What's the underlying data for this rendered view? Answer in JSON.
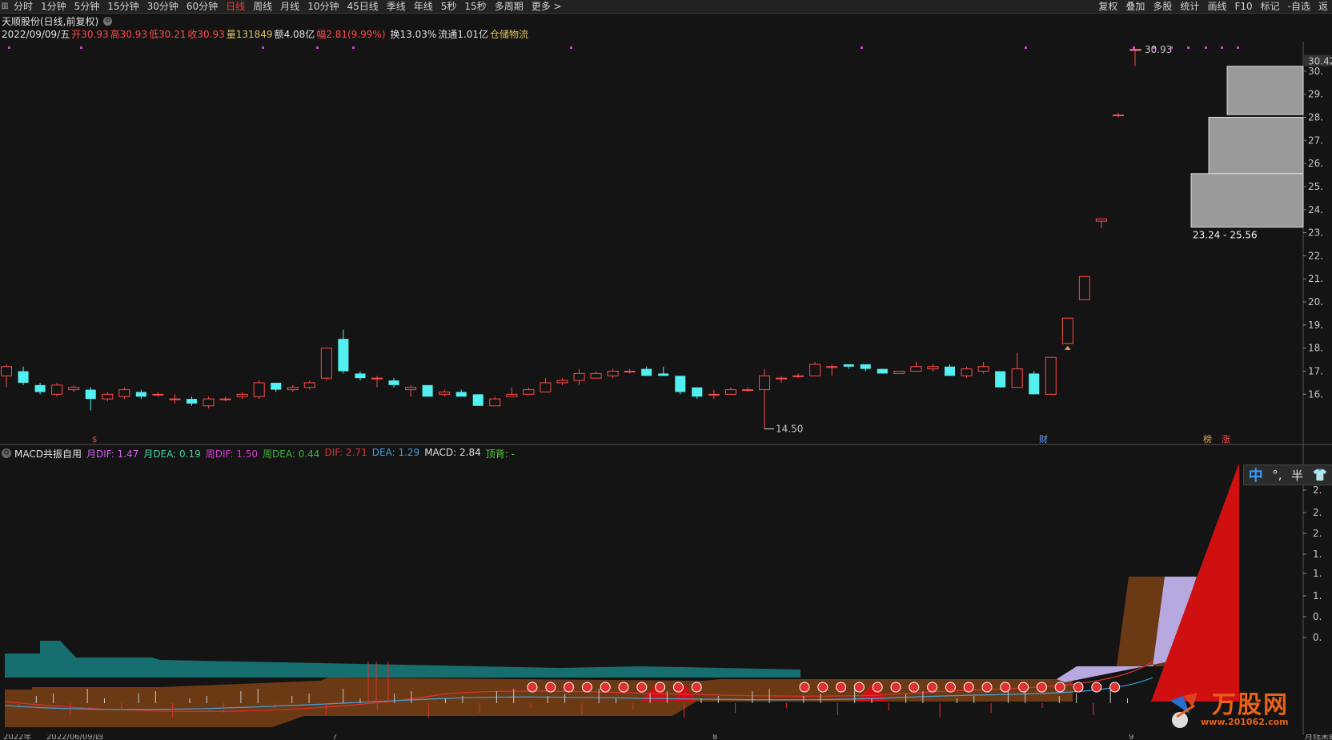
{
  "toolbar": {
    "left_items": [
      "分时",
      "1分钟",
      "5分钟",
      "15分钟",
      "30分钟",
      "60分钟",
      "日线",
      "周线",
      "月线",
      "10分钟",
      "45日线",
      "季线",
      "年线",
      "5秒",
      "15秒",
      "多周期",
      "更多 >"
    ],
    "active_index": 6,
    "right_items": [
      "复权",
      "叠加",
      "多股",
      "统计",
      "画线",
      "F10",
      "标记",
      "-自选",
      "返"
    ]
  },
  "stock": {
    "title": "天顺股份(日线,前复权)",
    "date": "2022/09/09/五",
    "open_label": "开",
    "open": "30.93",
    "high_label": "高",
    "high": "30.93",
    "low_label": "低",
    "low": "30.21",
    "close_label": "收",
    "close": "30.93",
    "volume_label": "量",
    "volume": "131849",
    "amount_label": "额",
    "amount": "4.08亿",
    "change_label": "幅",
    "change": "2.81(9.99%)",
    "turnover_label": "换",
    "turnover": "13.03%",
    "float_label": "流通",
    "float": "1.01亿",
    "sector": "仓储物流"
  },
  "price_axis": [
    "30.42",
    "30.",
    "29.",
    "28.",
    "27.",
    "26.",
    "25.",
    "24.",
    "23.",
    "22.",
    "21.",
    "20.",
    "19.",
    "18.",
    "17.",
    "16."
  ],
  "annotations": {
    "high_marker": "30.93",
    "low_marker": "14.50",
    "zones": [
      "28.12 - 30.21",
      "25.56 - 28.00",
      "23.24 - 25.56"
    ],
    "events": [
      "财",
      "榜",
      "涨"
    ],
    "early_marker": "$"
  },
  "indicator": {
    "name": "MACD共振自用",
    "items": [
      {
        "label": "月DIF:",
        "value": "1.47",
        "color": "#d060f0"
      },
      {
        "label": "月DEA:",
        "value": "0.19",
        "color": "#40d0a0"
      },
      {
        "label": "周DIF:",
        "value": "1.50",
        "color": "#d040d0"
      },
      {
        "label": "周DEA:",
        "value": "0.44",
        "color": "#40b040"
      },
      {
        "label": "DIF:",
        "value": "2.71",
        "color": "#e03030"
      },
      {
        "label": "DEA:",
        "value": "1.29",
        "color": "#40a0e0"
      },
      {
        "label": "MACD:",
        "value": "2.84",
        "color": "#e0e0e0"
      },
      {
        "label": "顶背:",
        "value": "-",
        "color": "#60d040"
      }
    ],
    "axis": [
      "2.",
      "2.",
      "2.",
      "1.",
      "1.",
      "1.",
      "0.",
      "0."
    ]
  },
  "ime": {
    "mode": "中",
    "punct": "°,",
    "width": "半"
  },
  "watermark": {
    "text": "万股网",
    "url": "www.201062.com"
  },
  "bottom_axis": [
    "2022年",
    "2022/06/09/四",
    "7",
    "8",
    "9"
  ],
  "bottom_left_label": "月线未数据",
  "colors": {
    "up": "#ff4a4a",
    "down": "#52f0f0",
    "bg": "#141414",
    "teal": "#176e6e",
    "brown": "#6b3a14",
    "lavender": "#b8a8e0",
    "red_fill": "#d01010"
  },
  "chart_data": {
    "type": "candlestick",
    "ylim": [
      14.0,
      31.0
    ],
    "candles": [
      {
        "o": 16.8,
        "c": 17.2,
        "h": 17.3,
        "l": 16.3
      },
      {
        "o": 17.0,
        "c": 16.5,
        "h": 17.2,
        "l": 16.4
      },
      {
        "o": 16.4,
        "c": 16.1,
        "h": 16.5,
        "l": 16.0
      },
      {
        "o": 16.0,
        "c": 16.4,
        "h": 16.5,
        "l": 15.9
      },
      {
        "o": 16.2,
        "c": 16.3,
        "h": 16.4,
        "l": 16.1
      },
      {
        "o": 16.2,
        "c": 15.8,
        "h": 16.3,
        "l": 15.3
      },
      {
        "o": 15.8,
        "c": 16.0,
        "h": 16.1,
        "l": 15.7
      },
      {
        "o": 15.9,
        "c": 16.2,
        "h": 16.3,
        "l": 15.8
      },
      {
        "o": 16.1,
        "c": 15.9,
        "h": 16.2,
        "l": 15.8
      },
      {
        "o": 16.0,
        "c": 16.0,
        "h": 16.1,
        "l": 15.9
      },
      {
        "o": 15.8,
        "c": 15.8,
        "h": 16.0,
        "l": 15.6
      },
      {
        "o": 15.8,
        "c": 15.6,
        "h": 15.9,
        "l": 15.5
      },
      {
        "o": 15.5,
        "c": 15.8,
        "h": 15.9,
        "l": 15.4
      },
      {
        "o": 15.8,
        "c": 15.8,
        "h": 15.9,
        "l": 15.7
      },
      {
        "o": 15.9,
        "c": 16.0,
        "h": 16.1,
        "l": 15.8
      },
      {
        "o": 15.9,
        "c": 16.5,
        "h": 16.6,
        "l": 15.8
      },
      {
        "o": 16.5,
        "c": 16.2,
        "h": 16.5,
        "l": 16.1
      },
      {
        "o": 16.2,
        "c": 16.3,
        "h": 16.4,
        "l": 16.1
      },
      {
        "o": 16.3,
        "c": 16.5,
        "h": 16.6,
        "l": 16.2
      },
      {
        "o": 16.7,
        "c": 18.0,
        "h": 18.0,
        "l": 16.6
      },
      {
        "o": 18.4,
        "c": 17.0,
        "h": 18.8,
        "l": 16.9
      },
      {
        "o": 16.9,
        "c": 16.7,
        "h": 17.0,
        "l": 16.6
      },
      {
        "o": 16.7,
        "c": 16.7,
        "h": 16.8,
        "l": 16.3
      },
      {
        "o": 16.6,
        "c": 16.4,
        "h": 16.7,
        "l": 16.3
      },
      {
        "o": 16.2,
        "c": 16.3,
        "h": 16.4,
        "l": 15.9
      },
      {
        "o": 16.4,
        "c": 15.9,
        "h": 16.4,
        "l": 15.9
      },
      {
        "o": 16.0,
        "c": 16.1,
        "h": 16.2,
        "l": 15.9
      },
      {
        "o": 16.1,
        "c": 15.9,
        "h": 16.2,
        "l": 15.9
      },
      {
        "o": 16.0,
        "c": 15.5,
        "h": 16.0,
        "l": 15.5
      },
      {
        "o": 15.5,
        "c": 15.8,
        "h": 15.9,
        "l": 15.5
      },
      {
        "o": 15.9,
        "c": 16.0,
        "h": 16.3,
        "l": 15.9
      },
      {
        "o": 16.0,
        "c": 16.2,
        "h": 16.3,
        "l": 16.0
      },
      {
        "o": 16.1,
        "c": 16.5,
        "h": 16.7,
        "l": 16.1
      },
      {
        "o": 16.5,
        "c": 16.6,
        "h": 16.7,
        "l": 16.4
      },
      {
        "o": 16.6,
        "c": 16.9,
        "h": 17.1,
        "l": 16.4
      },
      {
        "o": 16.7,
        "c": 16.9,
        "h": 17.0,
        "l": 16.7
      },
      {
        "o": 16.8,
        "c": 17.0,
        "h": 17.1,
        "l": 16.7
      },
      {
        "o": 17.0,
        "c": 17.0,
        "h": 17.1,
        "l": 16.9
      },
      {
        "o": 17.1,
        "c": 16.8,
        "h": 17.2,
        "l": 16.8
      },
      {
        "o": 16.9,
        "c": 16.8,
        "h": 17.2,
        "l": 16.8
      },
      {
        "o": 16.8,
        "c": 16.1,
        "h": 16.8,
        "l": 16.0
      },
      {
        "o": 16.3,
        "c": 15.9,
        "h": 16.3,
        "l": 15.8
      },
      {
        "o": 16.0,
        "c": 16.0,
        "h": 16.2,
        "l": 15.8
      },
      {
        "o": 16.0,
        "c": 16.2,
        "h": 16.3,
        "l": 16.0
      },
      {
        "o": 16.2,
        "c": 16.2,
        "h": 16.3,
        "l": 16.1
      },
      {
        "o": 16.2,
        "c": 16.8,
        "h": 17.1,
        "l": 14.5
      },
      {
        "o": 16.7,
        "c": 16.7,
        "h": 16.8,
        "l": 16.5
      },
      {
        "o": 16.8,
        "c": 16.8,
        "h": 16.9,
        "l": 16.7
      },
      {
        "o": 16.8,
        "c": 17.3,
        "h": 17.4,
        "l": 16.8
      },
      {
        "o": 17.2,
        "c": 17.2,
        "h": 17.3,
        "l": 16.8
      },
      {
        "o": 17.3,
        "c": 17.2,
        "h": 17.3,
        "l": 17.1
      },
      {
        "o": 17.3,
        "c": 17.1,
        "h": 17.3,
        "l": 17.0
      },
      {
        "o": 17.1,
        "c": 16.9,
        "h": 17.1,
        "l": 16.9
      },
      {
        "o": 16.9,
        "c": 17.0,
        "h": 17.0,
        "l": 16.9
      },
      {
        "o": 17.0,
        "c": 17.2,
        "h": 17.4,
        "l": 17.0
      },
      {
        "o": 17.1,
        "c": 17.2,
        "h": 17.3,
        "l": 17.0
      },
      {
        "o": 17.2,
        "c": 16.8,
        "h": 17.3,
        "l": 16.8
      },
      {
        "o": 16.8,
        "c": 17.1,
        "h": 17.2,
        "l": 16.7
      },
      {
        "o": 17.0,
        "c": 17.2,
        "h": 17.4,
        "l": 16.9
      },
      {
        "o": 17.0,
        "c": 16.3,
        "h": 17.0,
        "l": 16.3
      },
      {
        "o": 16.3,
        "c": 17.1,
        "h": 17.8,
        "l": 16.3
      },
      {
        "o": 16.9,
        "c": 16.0,
        "h": 17.0,
        "l": 16.0
      },
      {
        "o": 16.0,
        "c": 17.6,
        "h": 17.6,
        "l": 16.0
      },
      {
        "o": 18.2,
        "c": 19.3,
        "h": 19.3,
        "l": 18.2
      },
      {
        "o": 20.1,
        "c": 21.1,
        "h": 21.1,
        "l": 20.1
      },
      {
        "o": 23.5,
        "c": 23.6,
        "h": 23.6,
        "l": 23.2
      },
      {
        "o": 28.1,
        "c": 28.1,
        "h": 28.2,
        "l": 28.0
      },
      {
        "o": 30.93,
        "c": 30.93,
        "h": 30.93,
        "l": 30.21
      }
    ]
  }
}
